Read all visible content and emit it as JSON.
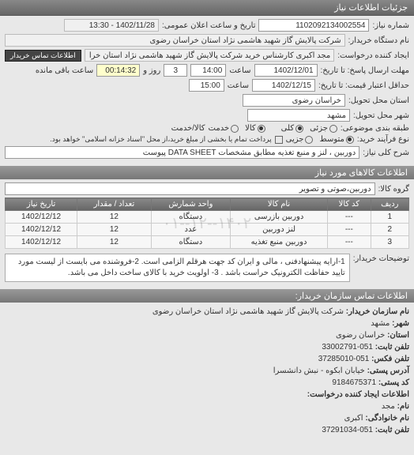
{
  "header": {
    "title": "جزئیات اطلاعات نیاز"
  },
  "form": {
    "need_no_label": "شماره نیاز:",
    "need_no": "1102092134002554",
    "announce_label": "تاریخ و ساعت اعلان عمومی:",
    "announce_value": "1402/11/28 - 13:30",
    "buyer_org_label": "نام دستگاه خریدار:",
    "buyer_org": "شرکت پالایش گاز شهید هاشمی نژاد   استان خراسان رضوی",
    "requester_label": "ایجاد کننده درخواست:",
    "requester": "مجد اکبری کارشناس خرید شرکت پالایش گاز شهید هاشمی نژاد   استان خرا",
    "buyer_contact_btn": "اطلاعات تماس خریدار",
    "deadline_label": "مهلت ارسال پاسخ: تا تاریخ:",
    "deadline_date": "1402/12/01",
    "time_label": "ساعت",
    "deadline_time": "14:00",
    "days_left": "3",
    "days_left_suffix": "روز و",
    "time_left": "00:14:32",
    "time_left_suffix": "ساعت باقی مانده",
    "validity_label": "حداقل اعتبار قیمت: تا تاریخ:",
    "validity_date": "1402/12/15",
    "validity_time": "15:00",
    "delivery_prov_label": "استان محل تحویل:",
    "delivery_prov": "خراسان رضوی",
    "delivery_city_label": "شهر محل تحویل:",
    "delivery_city": "مشهد",
    "partial_label": "طبقه بندی موضوعی:",
    "radio_partial": "جزئی",
    "radio_total": "کلی",
    "unit_label": "کالا/خدمت",
    "radio_goods": "کالا",
    "radio_service": "خدمت",
    "payment_type_label": "نوع فرآیند خرید:",
    "payment_radio1": "متوسط",
    "payment_radio2": "جزیی",
    "payment_note": "پرداخت تمام یا بخشی از مبلغ خرید،از محل \"اسناد خزانه اسلامی\" خواهد بود.",
    "desc_label": "شرح کلی نیاز:",
    "desc": "دوربین ، لنز و منبع تغذیه مطابق مشخصات DATA SHEET پیوست"
  },
  "items_section": {
    "title": "اطلاعات کالاهای مورد نیاز",
    "group_label": "گروه کالا:",
    "group_value": "دوربین،صوتی و تصویر",
    "cols": {
      "row": "ردیف",
      "code": "کد کالا",
      "name": "نام کالا",
      "req_unit": "واحد شمارش",
      "qty": "تعداد / مقدار",
      "need_date": "تاریخ نیاز"
    },
    "rows": [
      {
        "n": "1",
        "code": "---",
        "name": "دوربین بازرسی",
        "unit": "دستگاه",
        "qty": "12",
        "date": "1402/12/12"
      },
      {
        "n": "2",
        "code": "---",
        "name": "لنز دوربین",
        "unit": "عدد",
        "qty": "12",
        "date": "1402/12/12"
      },
      {
        "n": "3",
        "code": "---",
        "name": "دوربین منبع تغذیه",
        "unit": "دستگاه",
        "qty": "12",
        "date": "1402/12/12"
      }
    ],
    "watermark": "۱۴۰۲--۱۲--۰۱"
  },
  "buyer_note": {
    "label": "توضیحات خریدار:",
    "text": "1-ارایه پیشنهادفنی ، مالی و ایران کد جهت هرقلم الزامی است. 2-فروشنده می بایست از لیست مورد تایید حفاظت الکترونیک حراست باشد . 3- اولویت خرید با کالای ساخت داخل می باشد."
  },
  "contact": {
    "title": "اطلاعات تماس سازمان خریدار:",
    "org_label": "نام سازمان خریدار:",
    "org": "شرکت پالایش گاز شهید هاشمی نژاد استان خراسان رضوی",
    "city_label": "شهر:",
    "city": "مشهد",
    "prov_label": "استان:",
    "prov": "خراسان رضوی",
    "tel_label": "تلفن ثابت:",
    "tel": "051-33002791",
    "fax_label": "تلفن فکس:",
    "fax": "051-37285010",
    "addr_label": "آدرس پستی:",
    "addr": "خیابان ابکوه - نبش دانشسرا",
    "post_label": "کد پستی:",
    "post": "9184675371",
    "req_creator_label": "اطلاعات ایجاد کننده درخواست:",
    "name_label": "نام:",
    "name": "مجد",
    "lname_label": "نام خانوادگی:",
    "lname": "اکبری",
    "phone_label": "تلفن ثابت:",
    "phone": "051-37291034"
  }
}
